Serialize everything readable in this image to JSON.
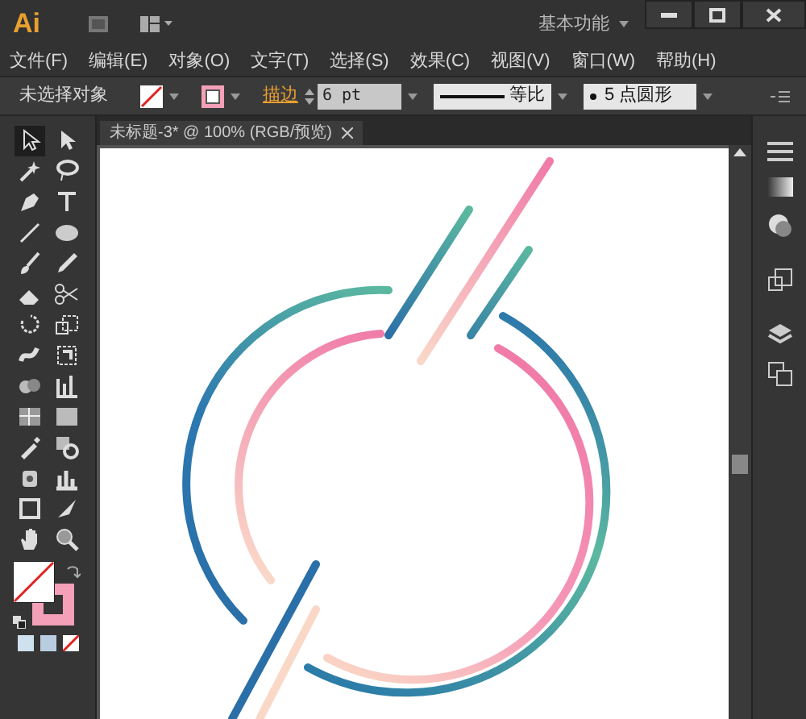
{
  "title_bar": {
    "logo": "Ai",
    "workspace": "基本功能"
  },
  "menu": [
    "文件(F)",
    "编辑(E)",
    "对象(O)",
    "文字(T)",
    "选择(S)",
    "效果(C)",
    "视图(V)",
    "窗口(W)",
    "帮助(H)"
  ],
  "control_bar": {
    "selection": "未选择对象",
    "stroke_label": "描边",
    "stroke_weight": "6 pt",
    "profile": "等比",
    "brush": "5 点圆形"
  },
  "document_tab": {
    "title": "未标题-3* @ 100% (RGB/预览)"
  },
  "tools": [
    {
      "kind": "selection",
      "selected": true
    },
    {
      "kind": "direct-selection",
      "selected": false
    },
    {
      "kind": "magic-wand",
      "selected": false
    },
    {
      "kind": "lasso",
      "selected": false
    },
    {
      "kind": "pen",
      "selected": false
    },
    {
      "kind": "type",
      "selected": false
    },
    {
      "kind": "line",
      "selected": false
    },
    {
      "kind": "ellipse",
      "selected": false
    },
    {
      "kind": "brush",
      "selected": false
    },
    {
      "kind": "pencil",
      "selected": false
    },
    {
      "kind": "eraser",
      "selected": false
    },
    {
      "kind": "scissors",
      "selected": false
    },
    {
      "kind": "rotate",
      "selected": false
    },
    {
      "kind": "scale",
      "selected": false
    },
    {
      "kind": "warp",
      "selected": false
    },
    {
      "kind": "free-transform",
      "selected": false
    },
    {
      "kind": "shape-builder",
      "selected": false
    },
    {
      "kind": "graph",
      "selected": false
    },
    {
      "kind": "mesh",
      "selected": false
    },
    {
      "kind": "gradient",
      "selected": false
    },
    {
      "kind": "eyedropper",
      "selected": false
    },
    {
      "kind": "blend",
      "selected": false
    },
    {
      "kind": "symbol",
      "selected": false
    },
    {
      "kind": "column-graph",
      "selected": false
    },
    {
      "kind": "artboard",
      "selected": false
    },
    {
      "kind": "slice",
      "selected": false
    },
    {
      "kind": "hand",
      "selected": false
    },
    {
      "kind": "zoom",
      "selected": false
    }
  ]
}
